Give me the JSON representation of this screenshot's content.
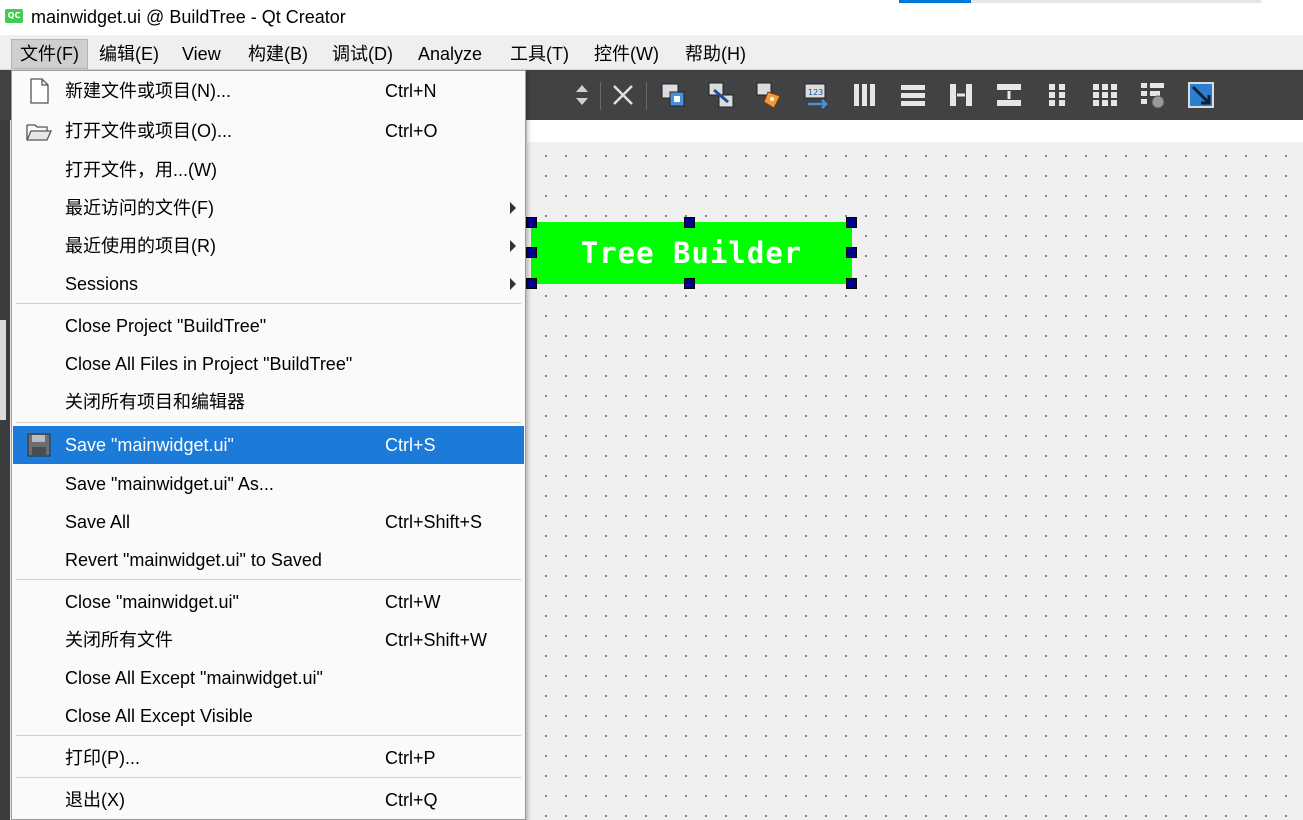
{
  "window": {
    "title": "mainwidget.ui @ BuildTree - Qt Creator",
    "app_icon": "QC"
  },
  "menubar": {
    "items": [
      "文件(F)",
      "编辑(E)",
      "View",
      "构建(B)",
      "调试(D)",
      "Analyze",
      "工具(T)",
      "控件(W)",
      "帮助(H)"
    ],
    "active_index": 0
  },
  "toolbar": {
    "icons": [
      "sort-arrows-icon",
      "close-x-icon",
      "edit-widgets-icon",
      "edit-signals-icon",
      "edit-buddies-icon",
      "edit-tab-order-icon",
      "layout-horizontal-icon",
      "layout-vertical-icon",
      "layout-h-splitter-icon",
      "layout-v-splitter-icon",
      "layout-form-icon",
      "layout-grid-icon",
      "break-layout-icon",
      "adjust-size-icon"
    ]
  },
  "canvas": {
    "widget_text": "Tree Builder",
    "widget_color": "#00ff00"
  },
  "file_menu": {
    "items": [
      {
        "label": "新建文件或项目(N)...",
        "shortcut": "Ctrl+N",
        "icon": "new-file-icon"
      },
      {
        "label": "打开文件或项目(O)...",
        "shortcut": "Ctrl+O",
        "icon": "open-folder-icon"
      },
      {
        "label": "打开文件，用...(W)",
        "shortcut": ""
      },
      {
        "label": "最近访问的文件(F)",
        "shortcut": "",
        "submenu": true
      },
      {
        "label": "最近使用的项目(R)",
        "shortcut": "",
        "submenu": true
      },
      {
        "label": "Sessions",
        "shortcut": "",
        "submenu": true
      },
      {
        "label": "Close Project \"BuildTree\"",
        "shortcut": ""
      },
      {
        "label": "Close All Files in Project \"BuildTree\"",
        "shortcut": ""
      },
      {
        "label": "关闭所有项目和编辑器",
        "shortcut": ""
      },
      {
        "label": "Save \"mainwidget.ui\"",
        "shortcut": "Ctrl+S",
        "icon": "save-icon",
        "highlighted": true
      },
      {
        "label": "Save \"mainwidget.ui\" As...",
        "shortcut": ""
      },
      {
        "label": "Save All",
        "shortcut": "Ctrl+Shift+S"
      },
      {
        "label": "Revert \"mainwidget.ui\" to Saved",
        "shortcut": ""
      },
      {
        "label": "Close \"mainwidget.ui\"",
        "shortcut": "Ctrl+W"
      },
      {
        "label": "关闭所有文件",
        "shortcut": "Ctrl+Shift+W"
      },
      {
        "label": "Close All Except \"mainwidget.ui\"",
        "shortcut": ""
      },
      {
        "label": "Close All Except Visible",
        "shortcut": ""
      },
      {
        "label": "打印(P)...",
        "shortcut": "Ctrl+P"
      },
      {
        "label": "退出(X)",
        "shortcut": "Ctrl+Q"
      }
    ]
  },
  "colors": {
    "highlight": "#1c7ad8",
    "toolbar_bg": "#404244",
    "accent": "#0078d7"
  }
}
